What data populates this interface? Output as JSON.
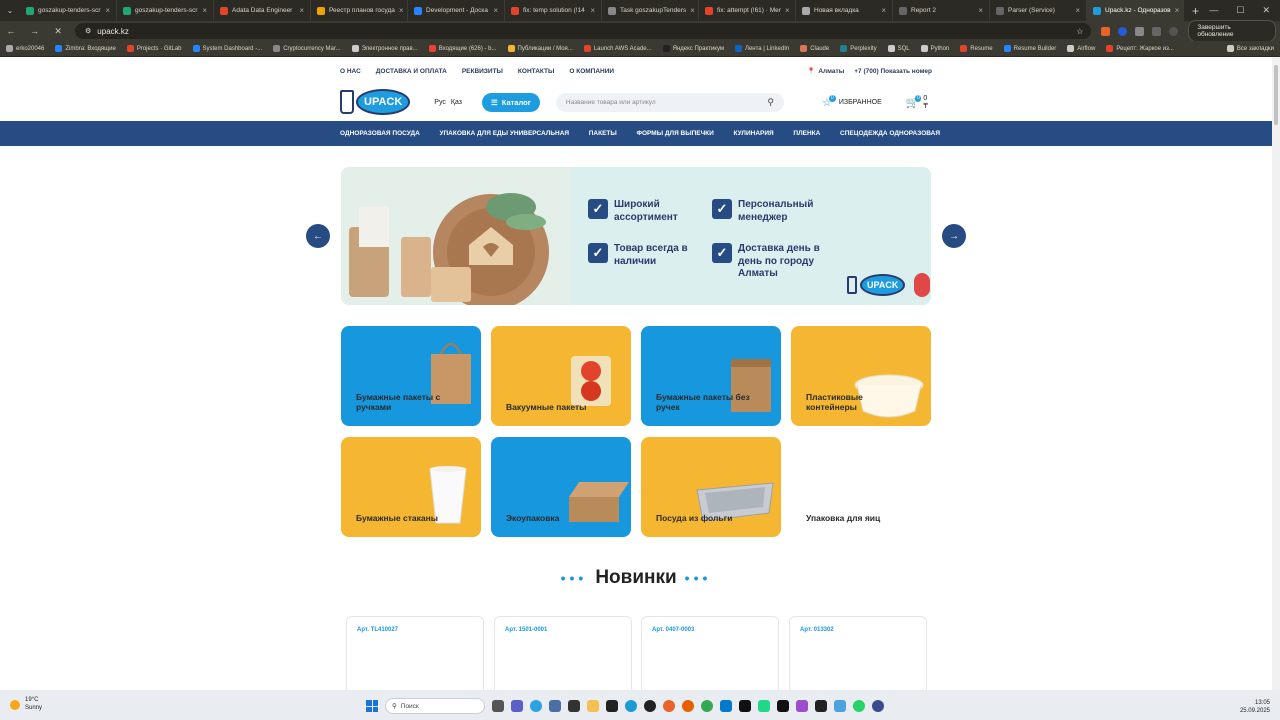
{
  "browser": {
    "tabs": [
      {
        "label": "goszakup-tenders-scr",
        "color": "#1fa774"
      },
      {
        "label": "goszakup-tenders-scr",
        "color": "#1fa774"
      },
      {
        "label": "Adata Data Engineer",
        "color": "#e2432a"
      },
      {
        "label": "Реестр планов госуда",
        "color": "#f1a300"
      },
      {
        "label": "Development - Доска",
        "color": "#2684ff"
      },
      {
        "label": "fix: temp solution (!14",
        "color": "#e2432a"
      },
      {
        "label": "Task goszakupTenders",
        "color": "#888888"
      },
      {
        "label": "fix: attempt (!61) · Mer",
        "color": "#e2432a"
      },
      {
        "label": "Новая вкладка",
        "color": "#aaaaaa"
      },
      {
        "label": "Report 2",
        "color": "#666666"
      },
      {
        "label": "Parser (Service)",
        "color": "#666666"
      },
      {
        "label": "Upack.kz - Одноразов",
        "color": "#1d9ce0"
      }
    ],
    "url": "upack.kz",
    "update_label": "Завершить обновление",
    "bookmarks": [
      {
        "label": "erko20046",
        "color": "#aaaaaa"
      },
      {
        "label": "Zimbra: Входящие",
        "color": "#2684ff"
      },
      {
        "label": "Projects · GitLab",
        "color": "#e2432a"
      },
      {
        "label": "System Dashboard -...",
        "color": "#2684ff"
      },
      {
        "label": "Cryptocurrency Mar...",
        "color": "#888888"
      },
      {
        "label": "Электронное прав...",
        "color": "#cccccc"
      },
      {
        "label": "Входящие (626) - b...",
        "color": "#ea4335"
      },
      {
        "label": "Публикации / Моя...",
        "color": "#f5b731"
      },
      {
        "label": "Launch AWS Acade...",
        "color": "#e2432a"
      },
      {
        "label": "Яндекс Практикум",
        "color": "#222222"
      },
      {
        "label": "Лента | LinkedIn",
        "color": "#0a66c2"
      },
      {
        "label": "Claude",
        "color": "#d97757"
      },
      {
        "label": "Perplexity",
        "color": "#20808d"
      },
      {
        "label": "SQL",
        "color": "#cccccc"
      },
      {
        "label": "Python",
        "color": "#cccccc"
      },
      {
        "label": "Resume",
        "color": "#e2432a"
      },
      {
        "label": "Resume Builder",
        "color": "#2684ff"
      },
      {
        "label": "Airflow",
        "color": "#cccccc"
      },
      {
        "label": "Рецепт: Жаркое из...",
        "color": "#e2432a"
      }
    ],
    "all_bookmarks": "Все закладки"
  },
  "site": {
    "topnav": [
      "О НАС",
      "ДОСТАВКА И ОПЛАТА",
      "РЕКВИЗИТЫ",
      "КОНТАКТЫ",
      "О КОМПАНИИ"
    ],
    "city": "Алматы",
    "phone": "+7 (700) Показать номер",
    "logo_text": "UPACK",
    "lang": [
      "Рус",
      "Қаз"
    ],
    "catalog_label": "Каталог",
    "search_placeholder": "Название товара или артикул",
    "favorites_label": "ИЗБРАННОЕ",
    "favorites_count": "0",
    "cart_count": "0",
    "cart_total": "0 ₸",
    "categories": [
      "ОДНОРАЗОВАЯ ПОСУДА",
      "УПАКОВКА ДЛЯ ЕДЫ УНИВЕРСАЛЬНАЯ",
      "ПАКЕТЫ",
      "ФОРМЫ ДЛЯ ВЫПЕЧКИ",
      "КУЛИНАРИЯ",
      "ПЛЕНКА",
      "СПЕЦОДЕЖДА ОДНОРАЗОВАЯ"
    ],
    "banner": {
      "features": [
        "Широкий ассортимент",
        "Персональный менеджер",
        "Товар всегда в наличии",
        "Доставка день в день по городу Алматы"
      ],
      "logo_text": "UPACK"
    },
    "tiles": [
      {
        "label": "Бумажные пакеты с ручками",
        "style": "blue"
      },
      {
        "label": "Вакуумные пакеты",
        "style": "yellow"
      },
      {
        "label": "Бумажные пакеты без ручек",
        "style": "blue"
      },
      {
        "label": "Пластиковые контейнеры",
        "style": "yellow"
      },
      {
        "label": "Бумажные стаканы",
        "style": "yellow"
      },
      {
        "label": "Экоупаковка",
        "style": "blue"
      },
      {
        "label": "Посуда из фольги",
        "style": "yellow"
      },
      {
        "label": "Упаковка для яиц",
        "style": "plain"
      }
    ],
    "new_title": "Новинки",
    "products": [
      {
        "art": "Арт. TL410027"
      },
      {
        "art": "Арт. 1501-0001"
      },
      {
        "art": "Арт. 0407-0003"
      },
      {
        "art": "Арт. 013302"
      }
    ]
  },
  "taskbar": {
    "temp": "19°C",
    "weather": "Sunny",
    "search_label": "Поиск",
    "time": "13:05",
    "date": "25.09.2025"
  }
}
